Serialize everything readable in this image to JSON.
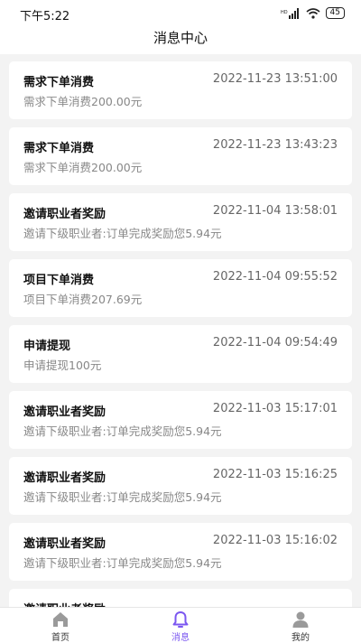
{
  "status_bar": {
    "time": "下午5:22",
    "battery": "45"
  },
  "header": {
    "title": "消息中心"
  },
  "messages": [
    {
      "title": "需求下单消费",
      "time": "2022-11-23 13:51:00",
      "desc": "需求下单消费200.00元"
    },
    {
      "title": "需求下单消费",
      "time": "2022-11-23 13:43:23",
      "desc": "需求下单消费200.00元"
    },
    {
      "title": "邀请职业者奖励",
      "time": "2022-11-04 13:58:01",
      "desc": "邀请下级职业者:订单完成奖励您5.94元"
    },
    {
      "title": "项目下单消费",
      "time": "2022-11-04 09:55:52",
      "desc": "项目下单消费207.69元"
    },
    {
      "title": "申请提现",
      "time": "2022-11-04 09:54:49",
      "desc": "申请提现100元"
    },
    {
      "title": "邀请职业者奖励",
      "time": "2022-11-03 15:17:01",
      "desc": "邀请下级职业者:订单完成奖励您5.94元"
    },
    {
      "title": "邀请职业者奖励",
      "time": "2022-11-03 15:16:25",
      "desc": "邀请下级职业者:订单完成奖励您5.94元"
    },
    {
      "title": "邀请职业者奖励",
      "time": "2022-11-03 15:16:02",
      "desc": "邀请下级职业者:订单完成奖励您5.94元"
    },
    {
      "title": "邀请职业者奖励",
      "time": "",
      "desc": ""
    }
  ],
  "tabs": [
    {
      "label": "首页",
      "icon": "home-icon"
    },
    {
      "label": "消息",
      "icon": "bell-icon"
    },
    {
      "label": "我的",
      "icon": "user-icon"
    }
  ],
  "colors": {
    "accent": "#7b57f0",
    "background": "#f3f3f3",
    "card": "#ffffff",
    "tab_icon": "#9a9a9a"
  }
}
